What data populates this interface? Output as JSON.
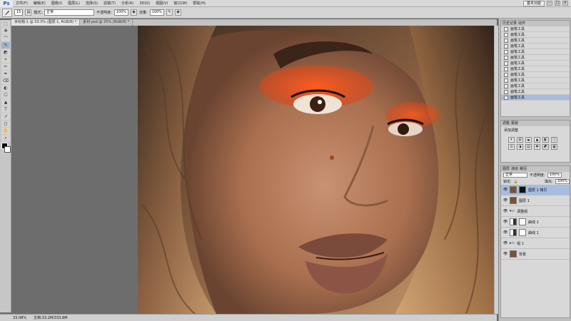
{
  "app": {
    "logo": "Ps"
  },
  "menu": [
    "文件(F)",
    "编辑(E)",
    "图像(I)",
    "图层(L)",
    "选择(S)",
    "滤镜(T)",
    "分析(A)",
    "3D(D)",
    "视图(V)",
    "窗口(W)",
    "帮助(H)"
  ],
  "workspace_label": "基本功能",
  "window_buttons": [
    "–",
    "□",
    "×"
  ],
  "options": {
    "brush_size": "15",
    "mode_label": "模式:",
    "mode_value": "正常",
    "opacity_label": "不透明度:",
    "opacity_value": "100%",
    "flow_label": "流量:",
    "flow_value": "100%"
  },
  "tools": [
    "⬚",
    "✥",
    "⌒",
    "✎",
    "◩",
    "⌖",
    "✂",
    "✒",
    "⌫",
    "◐",
    "☐",
    "▲",
    "T",
    "↗",
    "◻",
    "✋",
    "⌕"
  ],
  "doc_tabs": [
    {
      "label": "未标题-1 @ 33.3% (图层 1, RGB/8) *",
      "active": true
    },
    {
      "label": "素材.psd @ 25% (RGB/8) *",
      "active": false
    }
  ],
  "status": {
    "zoom": "33.08%",
    "doc": "文档:33.2M/333.8M"
  },
  "history": {
    "tabs": [
      "历史记录",
      "动作"
    ],
    "rows": [
      "画笔工具",
      "画笔工具",
      "画笔工具",
      "画笔工具",
      "画笔工具",
      "画笔工具",
      "画笔工具",
      "画笔工具",
      "画笔工具",
      "画笔工具",
      "画笔工具",
      "画笔工具",
      "画笔工具"
    ],
    "selected_index": 12
  },
  "adjustments": {
    "tabs": [
      "调整",
      "蒙版"
    ],
    "title": "添加调整",
    "icons": [
      "☀",
      "▥",
      "◒",
      "▲",
      "◧",
      "◫",
      "⚖",
      "◑",
      "▤",
      "◓",
      "◩",
      "▦"
    ]
  },
  "layers": {
    "tabs": [
      "图层",
      "通道",
      "路径"
    ],
    "blend_mode": "正常",
    "opacity_label": "不透明度:",
    "opacity_value": "100%",
    "fill_label": "填充:",
    "fill_value": "100%",
    "lock_label": "锁定:",
    "rows": [
      {
        "name": "图层 1 拷贝",
        "thumb": "black",
        "selected": true
      },
      {
        "name": "图层 1",
        "thumb": "photo",
        "selected": false
      },
      {
        "name": "调整组",
        "thumb": "",
        "selected": false
      },
      {
        "name": "曲线 1",
        "thumb": "adj",
        "selected": false
      },
      {
        "name": "曲线 1",
        "thumb": "adj",
        "selected": false
      },
      {
        "name": "组 1",
        "thumb": "",
        "selected": false
      },
      {
        "name": "背景",
        "thumb": "photo",
        "selected": false
      }
    ]
  }
}
